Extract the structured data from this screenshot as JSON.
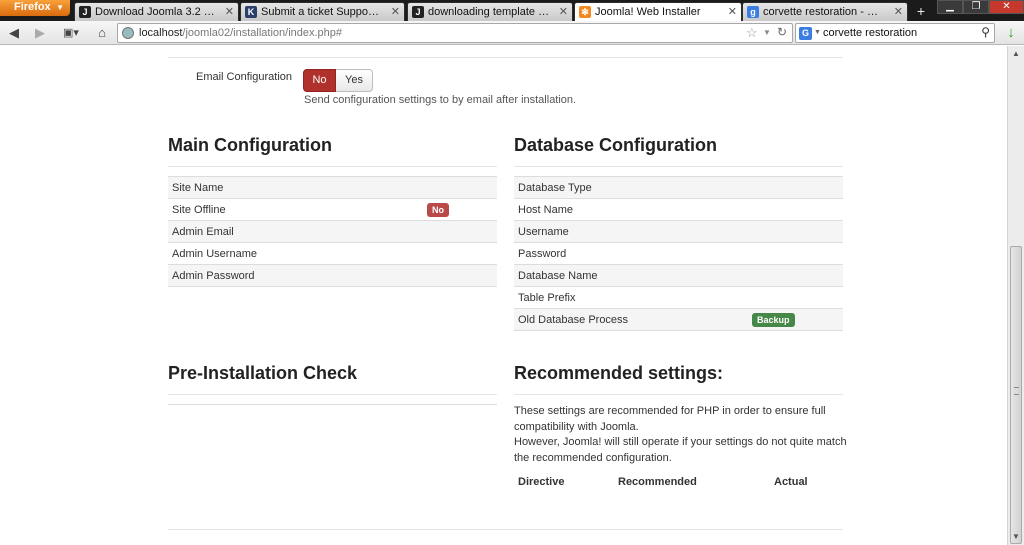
{
  "browser": {
    "app_button": "Firefox",
    "tabs": [
      {
        "title": "Download Joomla 3.2 Template...",
        "favicon": "joomla-favicon",
        "color": "#222"
      },
      {
        "title": "Submit a ticket Support Desk",
        "favicon": "k-favicon",
        "color": "#2a3f6a"
      },
      {
        "title": "downloading template as same ...",
        "favicon": "joomla-favicon",
        "color": "#222"
      },
      {
        "title": "Joomla! Web Installer",
        "favicon": "joomla-favicon",
        "color": "#f38a1f"
      },
      {
        "title": "corvette restoration - Google Se...",
        "favicon": "google-favicon",
        "color": "#3b7de0"
      }
    ],
    "active_tab": 3,
    "url_host": "localhost",
    "url_path": "/joomla02/installation/index.php#",
    "search_value": "corvette restoration",
    "search_engine": "G"
  },
  "email_config": {
    "label": "Email Configuration",
    "no_label": "No",
    "yes_label": "Yes",
    "selected": "No",
    "help": "Send configuration settings to by email after installation."
  },
  "main_config": {
    "title": "Main Configuration",
    "rows": [
      {
        "label": "Site Name",
        "badge": ""
      },
      {
        "label": "Site Offline",
        "badge": "No"
      },
      {
        "label": "Admin Email",
        "badge": ""
      },
      {
        "label": "Admin Username",
        "badge": ""
      },
      {
        "label": "Admin Password",
        "badge": ""
      }
    ]
  },
  "db_config": {
    "title": "Database Configuration",
    "rows": [
      {
        "label": "Database Type",
        "badge": ""
      },
      {
        "label": "Host Name",
        "badge": ""
      },
      {
        "label": "Username",
        "badge": ""
      },
      {
        "label": "Password",
        "badge": ""
      },
      {
        "label": "Database Name",
        "badge": ""
      },
      {
        "label": "Table Prefix",
        "badge": ""
      },
      {
        "label": "Old Database Process",
        "badge": "Backup"
      }
    ]
  },
  "pre_install": {
    "title": "Pre-Installation Check"
  },
  "recommended": {
    "title": "Recommended settings:",
    "line1": "These settings are recommended for PHP in order to ensure full",
    "line2": "compatibility with Joomla.",
    "line3": "However, Joomla! will still operate if your settings do not quite match",
    "line4": "the recommended configuration.",
    "col_directive": "Directive",
    "col_recommended": "Recommended",
    "col_actual": "Actual"
  },
  "colors": {
    "danger": "#b0302b",
    "success": "#468847",
    "firefox_orange": "#e57b16"
  }
}
